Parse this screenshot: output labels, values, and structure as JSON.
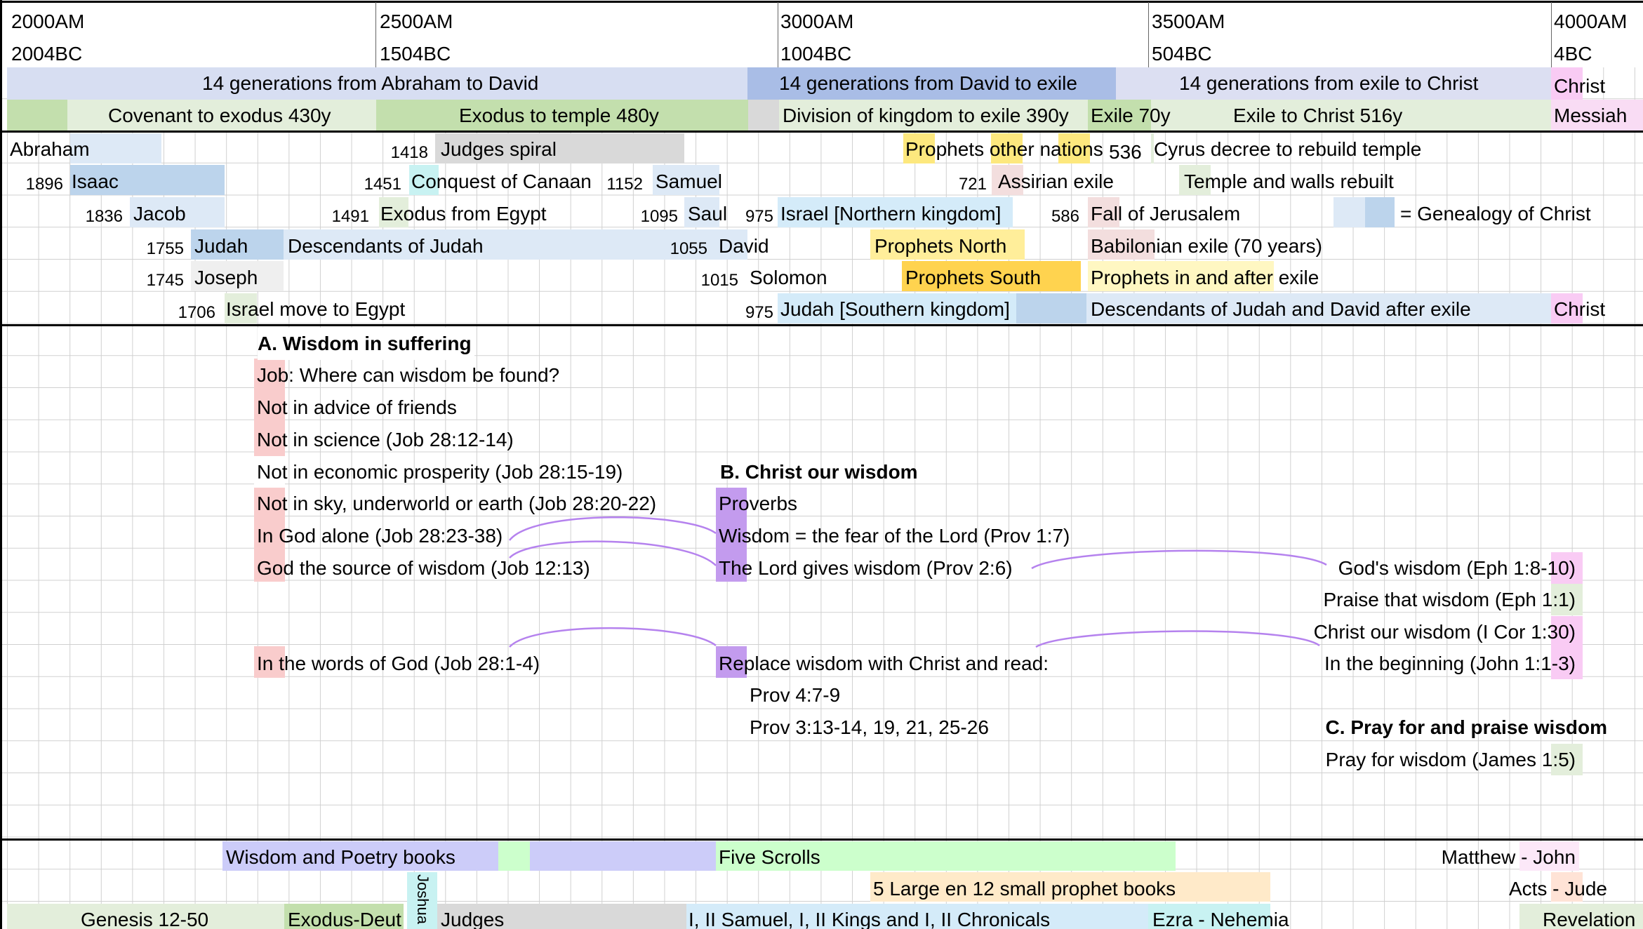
{
  "header": {
    "am": [
      "2000AM",
      "2500AM",
      "3000AM",
      "3500AM",
      "4000AM"
    ],
    "bc": [
      "2004BC",
      "1504BC",
      "1004BC",
      "504BC",
      "4BC"
    ]
  },
  "periods": {
    "generations": [
      "14 generations from Abraham to David",
      "14 generations from David to exile",
      "14 generations from exile to Christ",
      "Christ"
    ],
    "covenant": [
      "Covenant to exodus 430y",
      "Exodus to temple 480y",
      "Division of kingdom to exile 390y",
      "Exile 70y",
      "Exile to Christ 516y",
      "Messiah"
    ]
  },
  "timeline": {
    "abraham": "Abraham",
    "isaac_year": "1896",
    "isaac": "Isaac",
    "jacob_year": "1836",
    "jacob": "Jacob",
    "judah_year": "1755",
    "judah": "Judah",
    "descendants_judah": "Descendants of Judah",
    "joseph_year": "1745",
    "joseph": "Joseph",
    "egypt_year": "1706",
    "egypt": "Israel move to Egypt",
    "judges_year": "1418",
    "judges": "Judges spiral",
    "canaan_year": "1451",
    "canaan": "Conquest of Canaan",
    "exodus_year": "1491",
    "exodus": "Exodus from Egypt",
    "samuel_year": "1152",
    "samuel": "Samuel",
    "saul_year": "1095",
    "saul": "Saul",
    "david_year": "1055",
    "david": "David",
    "solomon_year": "1015",
    "solomon": "Solomon",
    "israel_year": "975",
    "israel": "Israel [Northern kingdom]",
    "judah_kingdom_year": "975",
    "judah_kingdom": "Judah [Southern kingdom]",
    "prophets_other": "Prophets other nations",
    "prophets_north": "Prophets North",
    "prophets_south": "Prophets South",
    "assirian_year": "721",
    "assirian": "Assirian exile",
    "fall_year": "586",
    "fall": "Fall of Jerusalem",
    "babilonian": "Babilonian exile (70 years)",
    "prophets_exile": "Prophets in and after exile",
    "cyrus_year": "536",
    "cyrus": "Cyrus decree to rebuild temple",
    "temple": "Temple and walls rebuilt",
    "genealogy": "= Genealogy of Christ",
    "after_exile": "Descendants of Judah and David after exile",
    "christ": "Christ"
  },
  "section_a": {
    "title": "A. Wisdom in suffering",
    "lines": [
      "Job: Where can wisdom be found?",
      "Not in advice of friends",
      "Not in science (Job 28:12-14)",
      "Not in economic prosperity (Job 28:15-19)",
      "Not in sky, underworld or earth (Job 28:20-22)",
      "In God alone (Job 28:23-38)",
      "God the source of wisdom (Job 12:13)"
    ],
    "words": "In the words of God (Job 28:1-4)"
  },
  "section_b": {
    "title": "B. Christ our wisdom",
    "lines": [
      "Proverbs",
      "Wisdom = the fear of the Lord (Prov 1:7)",
      "The Lord gives wisdom (Prov 2:6)"
    ],
    "replace": "Replace wisdom with Christ and read:",
    "refs": [
      "Prov 4:7-9",
      "Prov 3:13-14, 19, 21, 25-26"
    ]
  },
  "section_nt": {
    "lines": [
      "God's wisdom (Eph 1:8-10)",
      "Praise that wisdom (Eph 1:1)",
      "Christ our wisdom (I Cor 1:30)",
      "In the beginning (John 1:1-3)"
    ]
  },
  "section_c": {
    "title": "C. Pray for and praise wisdom",
    "lines": [
      "Pray for wisdom (James 1:5)"
    ]
  },
  "books": {
    "wisdom": "Wisdom and Poetry books",
    "scrolls": "Five Scrolls",
    "gospels": "Matthew - John",
    "prophets": "5 Large en 12 small prophet books",
    "acts": "Acts - Jude",
    "genesis": "Genesis 12-50",
    "exodus": "Exodus-Deut",
    "joshua": "Joshua",
    "judges": "Judges",
    "kings": "I, II Samuel, I, II Kings and I, II Chronicals",
    "ezra": "Ezra - Nehemia",
    "revelation": "Revelation"
  },
  "colors": {
    "lavender": "#ccd6ef",
    "blue": "#abbde4",
    "lightgreen": "#e3eedb",
    "green": "#c3dfad",
    "pink": "#f9cbf4",
    "yellow": "#fde87e",
    "gold": "#ffd34f",
    "salmon": "#f9cccc",
    "purple": "#c49bee",
    "curve": "#b582ee"
  }
}
